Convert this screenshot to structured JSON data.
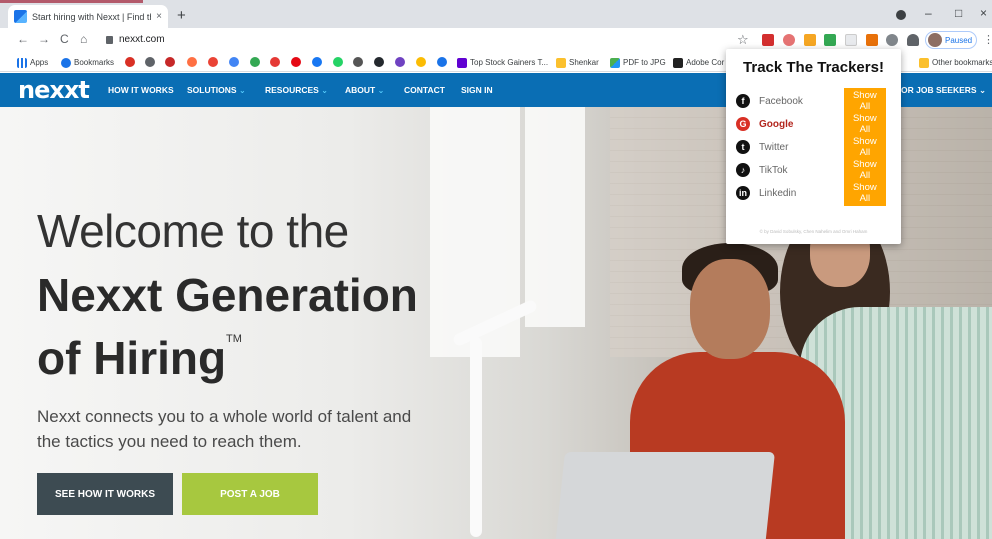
{
  "browser": {
    "tab_title": "Start hiring with Nexxt | Find the",
    "tab_close": "×",
    "new_tab": "+",
    "url": "nexxt.com",
    "profile_label": "Paused",
    "window_controls": {
      "minimize": "–",
      "maximize": "□",
      "close": "×"
    },
    "nav": {
      "back": "←",
      "forward": "→",
      "reload": "C",
      "home": "⌂"
    },
    "star": "☆",
    "menu": "⋮"
  },
  "bookmarks": {
    "apps_label": "Apps",
    "bookmarks_label": "Bookmarks",
    "top_stock": "Top Stock Gainers T...",
    "shenkar": "Shenkar",
    "pdf_to_jpg": "PDF to JPG",
    "adobe": "Adobe Cor",
    "other": "Other bookmarks"
  },
  "site_nav": {
    "logo": "nexxt",
    "links": [
      "HOW IT WORKS",
      "SOLUTIONS",
      "RESOURCES",
      "ABOUT",
      "CONTACT",
      "SIGN IN"
    ],
    "right_link": "OR JOB SEEKERS",
    "caret": "⌄"
  },
  "hero": {
    "line1": "Welcome to the",
    "line2": "Nexxt Generation",
    "line3": "of Hiring",
    "tm": "TM",
    "lead": "Nexxt connects you to a whole world of talent and the tactics you need to reach them.",
    "btn_primary": "SEE HOW IT WORKS",
    "btn_secondary": "POST A JOB",
    "colors": {
      "btn_primary": "#3d4b52",
      "btn_secondary": "#a7c83f",
      "nav": "#0a6eb4"
    }
  },
  "popup": {
    "title": "Track The Trackers!",
    "items": [
      {
        "name": "Facebook",
        "button": "Show All",
        "icon": "facebook-icon",
        "glyph": "f",
        "color": "#111111"
      },
      {
        "name": "Google",
        "button": "Show All",
        "icon": "google-icon",
        "glyph": "G",
        "color": "#d93025"
      },
      {
        "name": "Twitter",
        "button": "Show All",
        "icon": "twitter-icon",
        "glyph": "t",
        "color": "#111111"
      },
      {
        "name": "TikTok",
        "button": "Show All",
        "icon": "tiktok-icon",
        "glyph": "♪",
        "color": "#111111"
      },
      {
        "name": "Linkedin",
        "button": "Show All",
        "icon": "linkedin-icon",
        "glyph": "in",
        "color": "#111111"
      }
    ],
    "credit": "© by David Sobulsky, Chen Nahelim and Omri Haham"
  }
}
